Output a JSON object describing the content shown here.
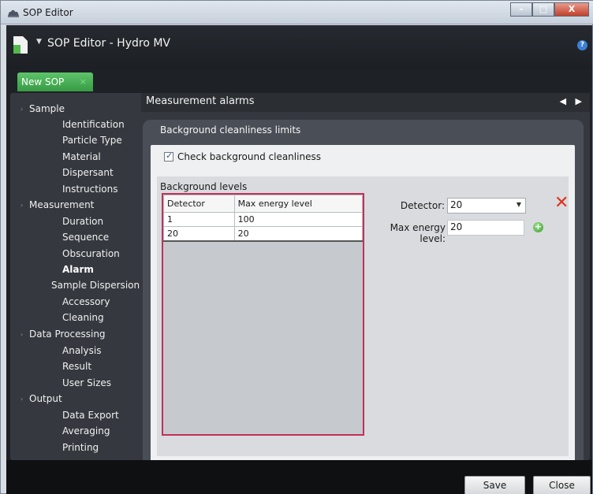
{
  "window": {
    "title": "SOP Editor",
    "controls": [
      "–",
      "□",
      "X"
    ]
  },
  "app": {
    "title": "SOP Editor - Hydro MV",
    "help_icon": "?"
  },
  "tabs": [
    {
      "label": "New SOP",
      "close": "×"
    }
  ],
  "nav": {
    "groups": [
      {
        "label": "Sample",
        "items": [
          "Identification",
          "Particle Type",
          "Material",
          "Dispersant",
          "Instructions"
        ]
      },
      {
        "label": "Measurement",
        "items": [
          "Duration",
          "Sequence",
          "Obscuration",
          "Alarm"
        ]
      },
      {
        "label": "Sample Dispersion",
        "items": [
          "Accessory",
          "Cleaning"
        ]
      },
      {
        "label": "Data Processing",
        "items": [
          "Analysis",
          "Result",
          "User Sizes"
        ]
      },
      {
        "label": "Output",
        "items": [
          "Data Export",
          "Averaging",
          "Printing"
        ]
      }
    ],
    "selected": "Alarm"
  },
  "content": {
    "title": "Measurement alarms",
    "nav_arrows": "◀ ▶",
    "panel_title": "Background cleanliness limits",
    "checkbox_label": "Check background cleanliness",
    "checkbox_checked": true,
    "levels_label": "Background levels",
    "table": {
      "headers": [
        "Detector",
        "Max energy level"
      ],
      "rows": [
        [
          "1",
          "100"
        ],
        [
          "20",
          "20"
        ]
      ]
    },
    "detector_label": "Detector:",
    "detector_value": "20",
    "max_energy_label": "Max energy level:",
    "max_energy_value": "20"
  },
  "footer": {
    "save_label": "Save",
    "close_label": "Close"
  }
}
